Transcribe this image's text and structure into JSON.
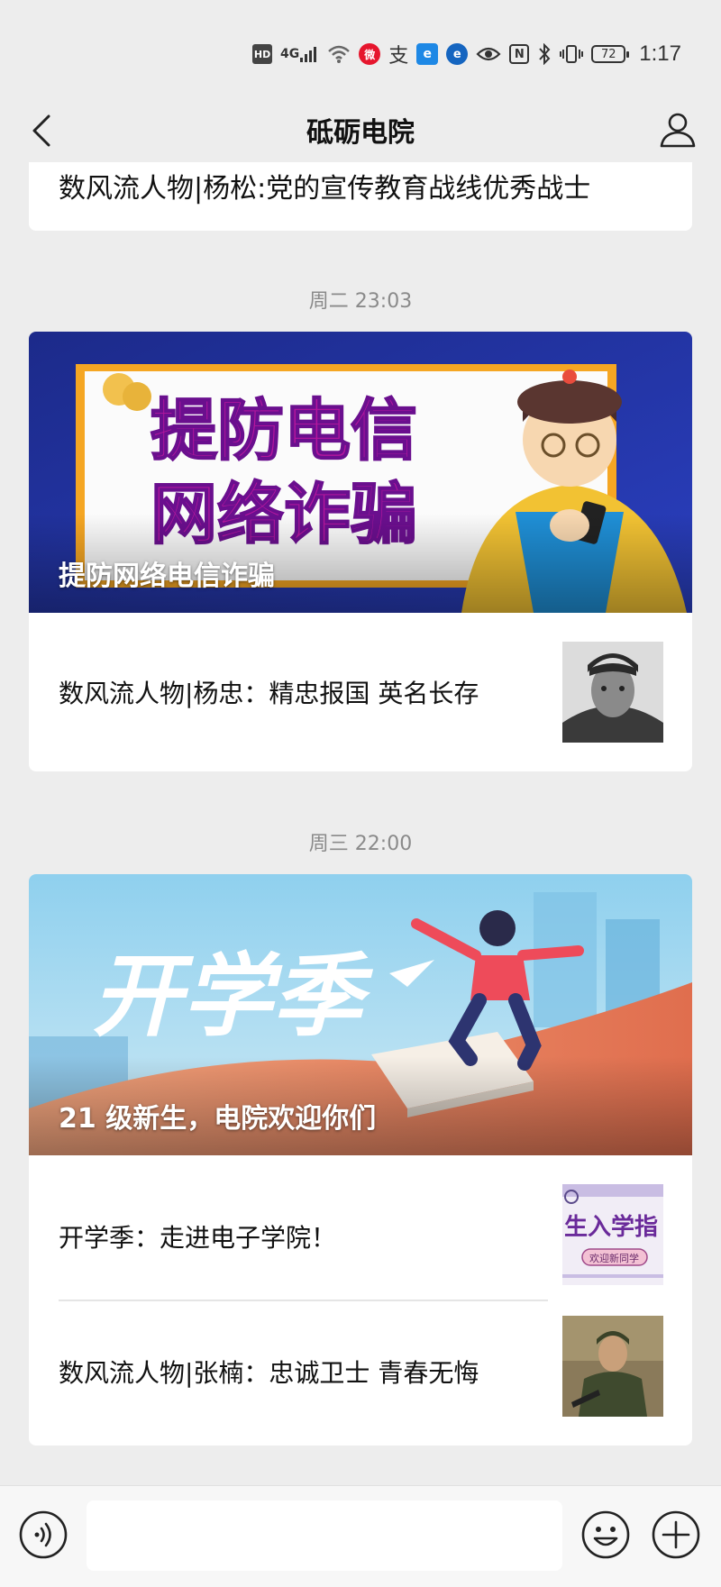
{
  "status_bar": {
    "time": "1:17",
    "battery": "72",
    "icons": [
      "hd-icon",
      "signal-4g-icon",
      "wifi-icon",
      "weibo-icon",
      "alipay-icon",
      "app-icon",
      "app-icon-2",
      "eye-icon",
      "nfc-icon",
      "bluetooth-icon",
      "vibrate-icon",
      "battery-icon"
    ],
    "hd_label": "HD",
    "signal_label": "4G",
    "nfc_label": "N"
  },
  "header": {
    "title": "砥砺电院",
    "back_icon": "chevron-left-icon",
    "profile_icon": "person-icon"
  },
  "feed": {
    "top_item": {
      "title": "数风流人物|杨松:党的宣传教育战线优秀战士"
    },
    "groups": [
      {
        "timestamp": "周二 23:03",
        "hero": {
          "caption": "提防网络电信诈骗",
          "banner_text_line1": "提防电信",
          "banner_text_line2": "网络诈骗"
        },
        "items": [
          {
            "title": "数风流人物|杨忠：精忠报国 英名长存"
          }
        ]
      },
      {
        "timestamp": "周三 22:00",
        "hero": {
          "caption": "21 级新生，电院欢迎你们",
          "banner_text": "开学季"
        },
        "items": [
          {
            "title": "开学季：走进电子学院！",
            "thumb_text": "生入学指",
            "thumb_subtext": "欢迎新同学"
          },
          {
            "title": "数风流人物|张楠：忠诚卫士 青春无悔"
          }
        ]
      }
    ]
  },
  "bottom_bar": {
    "input_value": "",
    "input_placeholder": "",
    "voice_icon": "voice-icon",
    "emoji_icon": "emoji-icon",
    "plus_icon": "plus-icon"
  },
  "colors": {
    "background": "#ededed",
    "card": "#ffffff",
    "timestamp": "#8a8a8a",
    "weibo_red": "#e6162d"
  }
}
